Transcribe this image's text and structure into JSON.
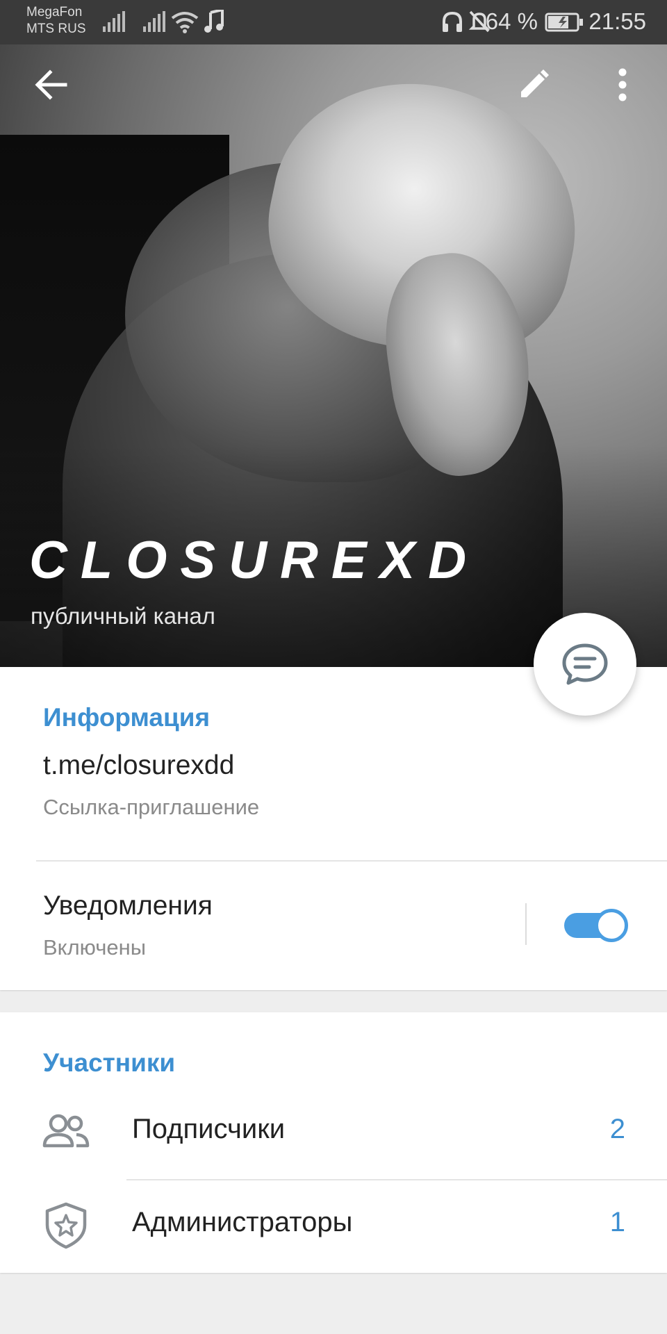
{
  "status_bar": {
    "carrier_1": "MegaFon",
    "carrier_2": "MTS RUS",
    "battery": "64 %",
    "time": "21:55"
  },
  "header": {
    "channel_name": "CLOSUREXD",
    "channel_type": "публичный канал",
    "icons": [
      "back-arrow-icon",
      "pencil-icon",
      "more-vert-icon",
      "message-icon"
    ]
  },
  "info": {
    "section_title": "Информация",
    "link": "t.me/closurexdd",
    "link_caption": "Ссылка-приглашение",
    "notifications_title": "Уведомления",
    "notifications_state": "Включены",
    "notifications_enabled": true
  },
  "members": {
    "section_title": "Участники",
    "rows": [
      {
        "label": "Подписчики",
        "count": "2",
        "icon": "people-icon"
      },
      {
        "label": "Администраторы",
        "count": "1",
        "icon": "admin-shield-icon"
      }
    ]
  },
  "colors": {
    "accent": "#3d8fd1",
    "toggle": "#4a9ee2"
  }
}
